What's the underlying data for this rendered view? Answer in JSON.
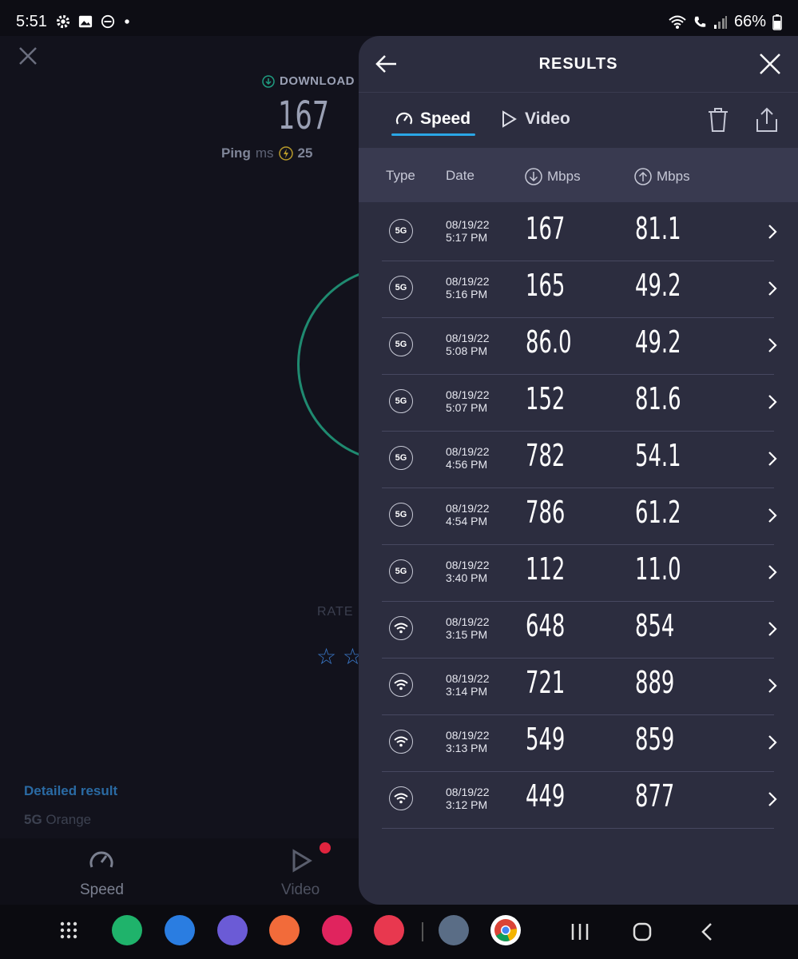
{
  "status_bar": {
    "time": "5:51",
    "battery": "66%"
  },
  "background_app": {
    "download_label": "DOWNLOAD",
    "download_value": "167",
    "ping_label": "Ping",
    "ping_unit": "ms",
    "ping_value": "25",
    "rate_label": "RATE",
    "detailed_result": "Detailed result",
    "network_type": "5G",
    "network_name": "Orange",
    "nav_speed": "Speed",
    "nav_video": "Video"
  },
  "panel": {
    "title": "RESULTS",
    "tabs": [
      {
        "label": "Speed"
      },
      {
        "label": "Video"
      }
    ],
    "columns": {
      "type": "Type",
      "date": "Date",
      "download": "Mbps",
      "upload": "Mbps"
    },
    "results": [
      {
        "type": "5G",
        "date": "08/19/22",
        "time": "5:17 PM",
        "download": "167",
        "upload": "81.1"
      },
      {
        "type": "5G",
        "date": "08/19/22",
        "time": "5:16 PM",
        "download": "165",
        "upload": "49.2"
      },
      {
        "type": "5G",
        "date": "08/19/22",
        "time": "5:08 PM",
        "download": "86.0",
        "upload": "49.2"
      },
      {
        "type": "5G",
        "date": "08/19/22",
        "time": "5:07 PM",
        "download": "152",
        "upload": "81.6"
      },
      {
        "type": "5G",
        "date": "08/19/22",
        "time": "4:56 PM",
        "download": "782",
        "upload": "54.1"
      },
      {
        "type": "5G",
        "date": "08/19/22",
        "time": "4:54 PM",
        "download": "786",
        "upload": "61.2"
      },
      {
        "type": "5G",
        "date": "08/19/22",
        "time": "3:40 PM",
        "download": "112",
        "upload": "11.0"
      },
      {
        "type": "wifi",
        "date": "08/19/22",
        "time": "3:15 PM",
        "download": "648",
        "upload": "854"
      },
      {
        "type": "wifi",
        "date": "08/19/22",
        "time": "3:14 PM",
        "download": "721",
        "upload": "889"
      },
      {
        "type": "wifi",
        "date": "08/19/22",
        "time": "3:13 PM",
        "download": "549",
        "upload": "859"
      },
      {
        "type": "wifi",
        "date": "08/19/22",
        "time": "3:12 PM",
        "download": "449",
        "upload": "877"
      }
    ]
  },
  "dock": [
    {
      "icon": "apps-grid-icon",
      "color": "#0b0b10"
    },
    {
      "icon": "phone-icon",
      "color": "#1fb36b"
    },
    {
      "icon": "messages-icon",
      "color": "#2a7de1"
    },
    {
      "icon": "internet-icon",
      "color": "#6b5bd6"
    },
    {
      "icon": "notes-icon",
      "color": "#f26b3a"
    },
    {
      "icon": "flower-icon",
      "color": "#e0245e"
    },
    {
      "icon": "camera-icon",
      "color": "#e8384f"
    },
    {
      "icon": "settings-icon",
      "color": "#5a6d86"
    },
    {
      "icon": "chrome-icon",
      "color": "#ffffff"
    }
  ]
}
